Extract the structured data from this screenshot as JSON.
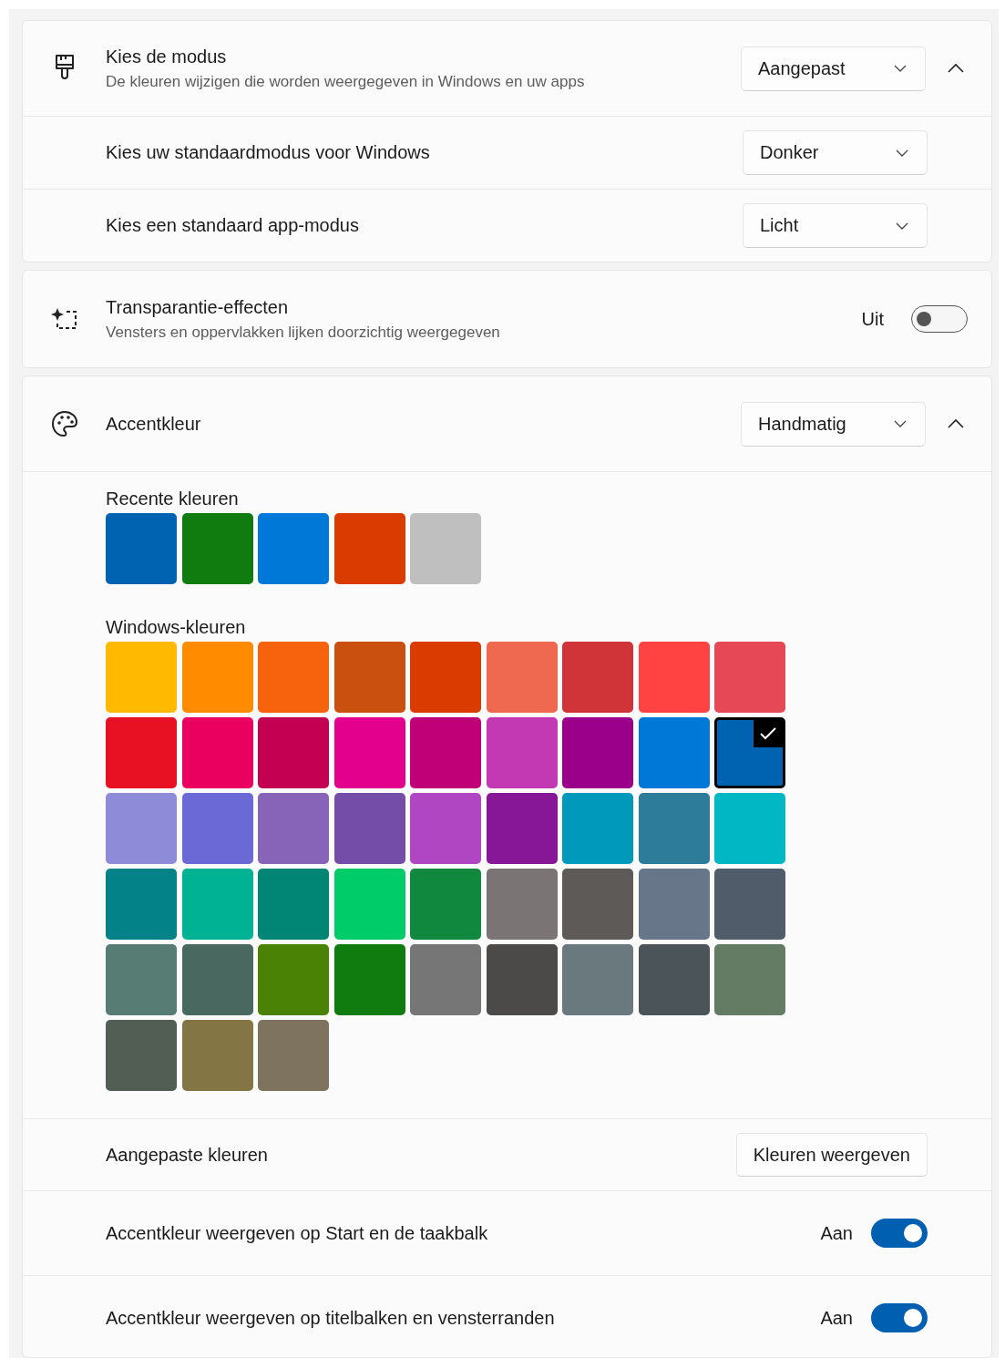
{
  "mode": {
    "title": "Kies de modus",
    "description": "De kleuren wijzigen die worden weergegeven in Windows en uw apps",
    "dropdown": "Aangepast",
    "expanded": true,
    "rows": [
      {
        "label": "Kies uw standaardmodus voor Windows",
        "dropdown": "Donker"
      },
      {
        "label": "Kies een standaard app-modus",
        "dropdown": "Licht"
      }
    ]
  },
  "transparency": {
    "title": "Transparantie-effecten",
    "description": "Vensters en oppervlakken lijken doorzichtig weergegeven",
    "state_label": "Uit",
    "on": false
  },
  "accent": {
    "title": "Accentkleur",
    "dropdown": "Handmatig",
    "expanded": true,
    "recent": {
      "label": "Recente kleuren",
      "colors": [
        {
          "color": "#0063b1"
        },
        {
          "color": "#107c10"
        },
        {
          "color": "#0078d7"
        },
        {
          "color": "#da3b01"
        },
        {
          "color": "#bfbfbf"
        }
      ]
    },
    "windows": {
      "label": "Windows-kleuren",
      "colors": [
        {
          "color": "#ffb900",
          "selected": false
        },
        {
          "color": "#ff8c00",
          "selected": false
        },
        {
          "color": "#f7630c",
          "selected": false
        },
        {
          "color": "#ca5010",
          "selected": false
        },
        {
          "color": "#da3b01",
          "selected": false
        },
        {
          "color": "#ef6950",
          "selected": false
        },
        {
          "color": "#d13438",
          "selected": false
        },
        {
          "color": "#ff4343",
          "selected": false
        },
        {
          "color": "#e74856",
          "selected": false
        },
        {
          "color": "#e81123",
          "selected": false
        },
        {
          "color": "#ea005e",
          "selected": false
        },
        {
          "color": "#c30052",
          "selected": false
        },
        {
          "color": "#e3008c",
          "selected": false
        },
        {
          "color": "#bf0077",
          "selected": false
        },
        {
          "color": "#c239b3",
          "selected": false
        },
        {
          "color": "#9a0089",
          "selected": false
        },
        {
          "color": "#0078d7",
          "selected": false
        },
        {
          "color": "#0063b1",
          "selected": true
        },
        {
          "color": "#8e8cd8",
          "selected": false
        },
        {
          "color": "#6b69d6",
          "selected": false
        },
        {
          "color": "#8764b8",
          "selected": false
        },
        {
          "color": "#744da9",
          "selected": false
        },
        {
          "color": "#b146c2",
          "selected": false
        },
        {
          "color": "#881798",
          "selected": false
        },
        {
          "color": "#0099bc",
          "selected": false
        },
        {
          "color": "#2d7d9a",
          "selected": false
        },
        {
          "color": "#00b7c3",
          "selected": false
        },
        {
          "color": "#038387",
          "selected": false
        },
        {
          "color": "#00b294",
          "selected": false
        },
        {
          "color": "#018574",
          "selected": false
        },
        {
          "color": "#00cc6a",
          "selected": false
        },
        {
          "color": "#10893e",
          "selected": false
        },
        {
          "color": "#7a7574",
          "selected": false
        },
        {
          "color": "#5d5a58",
          "selected": false
        },
        {
          "color": "#68768a",
          "selected": false
        },
        {
          "color": "#515c6b",
          "selected": false
        },
        {
          "color": "#567c73",
          "selected": false
        },
        {
          "color": "#486860",
          "selected": false
        },
        {
          "color": "#498205",
          "selected": false
        },
        {
          "color": "#107c10",
          "selected": false
        },
        {
          "color": "#767676",
          "selected": false
        },
        {
          "color": "#4c4a48",
          "selected": false
        },
        {
          "color": "#69797e",
          "selected": false
        },
        {
          "color": "#4a5459",
          "selected": false
        },
        {
          "color": "#647c64",
          "selected": false
        },
        {
          "color": "#525e54",
          "selected": false
        },
        {
          "color": "#847545",
          "selected": false
        },
        {
          "color": "#7e735f",
          "selected": false
        }
      ]
    },
    "custom": {
      "label": "Aangepaste kleuren",
      "button": "Kleuren weergeven"
    },
    "toggles": [
      {
        "label": "Accentkleur weergeven op Start en de taakbalk",
        "state_label": "Aan",
        "on": true
      },
      {
        "label": "Accentkleur weergeven op titelbalken en vensterranden",
        "state_label": "Aan",
        "on": true
      }
    ]
  }
}
